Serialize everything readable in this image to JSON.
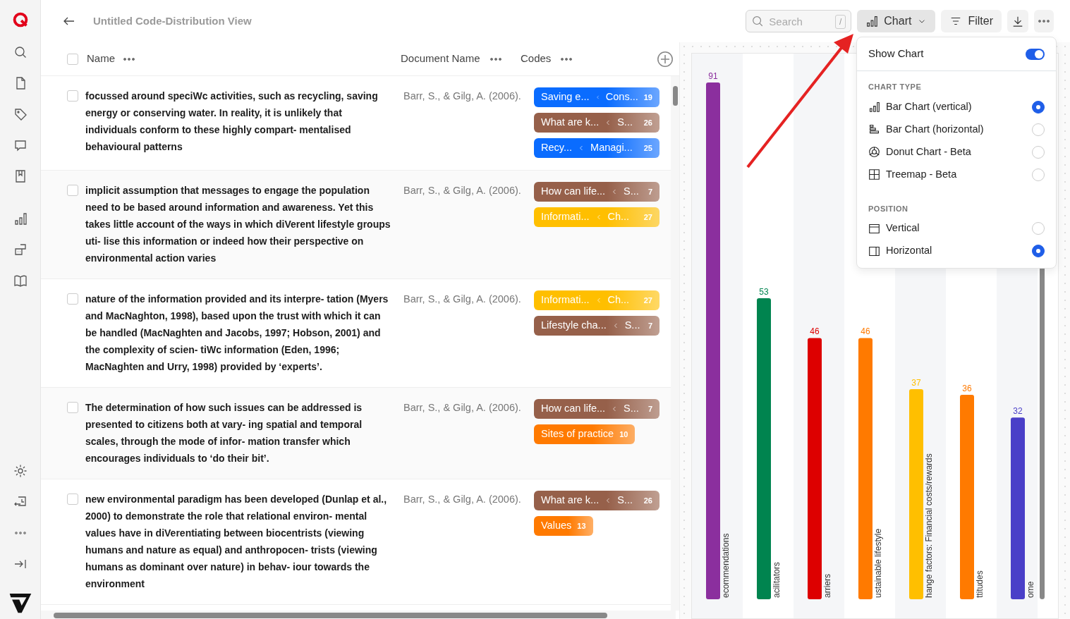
{
  "header": {
    "title": "Untitled Code-Distribution View"
  },
  "toolbar": {
    "search": {
      "placeholder": "Search",
      "shortcut": "/"
    },
    "chart_button": {
      "label": "Chart",
      "expanded": true
    },
    "filter_button": {
      "label": "Filter"
    }
  },
  "table": {
    "all_checked": false,
    "columns": [
      {
        "label": "Name"
      },
      {
        "label": "Document Name"
      },
      {
        "label": "Codes"
      }
    ],
    "rows": [
      {
        "checked": false,
        "text": "focussed around speciWc activities, such as recycling, saving energy or conserving water. In reality, it is unlikely that individuals conform to these highly compart- mentalised behavioural patterns",
        "document": "Barr, S., & Gilg, A. (2006).",
        "codes": [
          {
            "kind": "path",
            "code": "Saving e...",
            "parent": "Cons...",
            "count": "19",
            "color": "#0a6cff"
          },
          {
            "kind": "path",
            "code": "What are k...",
            "parent": "S...",
            "count": "26",
            "color": "#96604a"
          },
          {
            "kind": "path",
            "code": "Recy...",
            "parent": "Managi...",
            "count": "25",
            "color": "#0a6cff"
          }
        ]
      },
      {
        "checked": false,
        "text": "implicit assumption that messages to engage the population need to be based around information and awareness. Yet this takes little account of the ways in which diVerent lifestyle groups uti- lise this information or indeed how their perspective on environmental action varies",
        "document": "Barr, S., & Gilg, A. (2006).",
        "codes": [
          {
            "kind": "path",
            "code": "How can life...",
            "parent": "S...",
            "count": "7",
            "color": "#96604a"
          },
          {
            "kind": "path",
            "code": "Informati...",
            "parent": "Ch...",
            "count": "27",
            "color": "#ffbf00"
          }
        ]
      },
      {
        "checked": false,
        "text": "nature of the information provided and its interpre- tation (Myers and MacNaghton, 1998), based upon the trust with which it can be handled (MacNaghten and Jacobs, 1997; Hobson, 2001) and the complexity of scien- tiWc information (Eden, 1996; MacNaghten and Urry, 1998) provided by ‘experts’.",
        "document": "Barr, S., & Gilg, A. (2006).",
        "codes": [
          {
            "kind": "path",
            "code": "Informati...",
            "parent": "Ch...",
            "count": "27",
            "color": "#ffbf00"
          },
          {
            "kind": "path",
            "code": "Lifestyle cha...",
            "parent": "S...",
            "count": "7",
            "color": "#96604a"
          }
        ]
      },
      {
        "checked": false,
        "text": "The determination of how such issues can be addressed is presented to citizens both at vary- ing spatial and temporal scales, through the mode of infor- mation transfer which encourages individuals to ‘do their bit’.",
        "document": "Barr, S., & Gilg, A. (2006).",
        "codes": [
          {
            "kind": "path",
            "code": "How can life...",
            "parent": "S...",
            "count": "7",
            "color": "#96604a"
          },
          {
            "kind": "single",
            "code": "Sites of practice",
            "count": "10",
            "color": "#ff7a00"
          }
        ]
      },
      {
        "checked": false,
        "text": "new environmental paradigm has been developed (Dunlap et al., 2000) to demonstrate the role that relational environ- mental values have in diVerentiating between biocentrists (viewing humans and nature as equal) and anthropocen- trists (viewing humans as dominant over nature) in behav- iour towards the environment",
        "document": "Barr, S., & Gilg, A. (2006).",
        "codes": [
          {
            "kind": "path",
            "code": "What are k...",
            "parent": "S...",
            "count": "26",
            "color": "#96604a"
          },
          {
            "kind": "single",
            "code": "Values",
            "count": "13",
            "color": "#ff7a00"
          }
        ]
      }
    ]
  },
  "chart": {
    "bars": [
      {
        "color": "#8b2f9e"
      },
      {
        "color": "#00844f"
      },
      {
        "color": "#dd0000"
      },
      {
        "color": "#ff7a00"
      },
      {
        "color": "#ffbf00"
      },
      {
        "color": "#ff7a00"
      },
      {
        "color": "#4a3fc8"
      }
    ],
    "chart_data": {
      "type": "bar",
      "categories": [
        "ecommendations",
        "acilitators",
        "arriers",
        "ustainable lifestyle",
        "hange factors: Financial costs/rewards",
        "ttitudes",
        "ome"
      ],
      "values": [
        91,
        53,
        46,
        46,
        37,
        36,
        32
      ],
      "data_labels": true
    }
  },
  "chart_menu": {
    "show_chart": {
      "label": "Show Chart",
      "on": true
    },
    "sections": [
      {
        "title": "CHART TYPE",
        "options": [
          {
            "kind": "bar-vertical",
            "label": "Bar Chart (vertical)",
            "selected": true
          },
          {
            "kind": "bar-horizontal",
            "label": "Bar Chart (horizontal)",
            "selected": false
          },
          {
            "kind": "donut",
            "label": "Donut Chart - Beta",
            "selected": false
          },
          {
            "kind": "treemap",
            "label": "Treemap - Beta",
            "selected": false
          }
        ]
      },
      {
        "title": "POSITION",
        "options": [
          {
            "kind": "layout-vertical",
            "label": "Vertical",
            "selected": false
          },
          {
            "kind": "layout-horizontal",
            "label": "Horizontal",
            "selected": true
          }
        ]
      }
    ]
  }
}
